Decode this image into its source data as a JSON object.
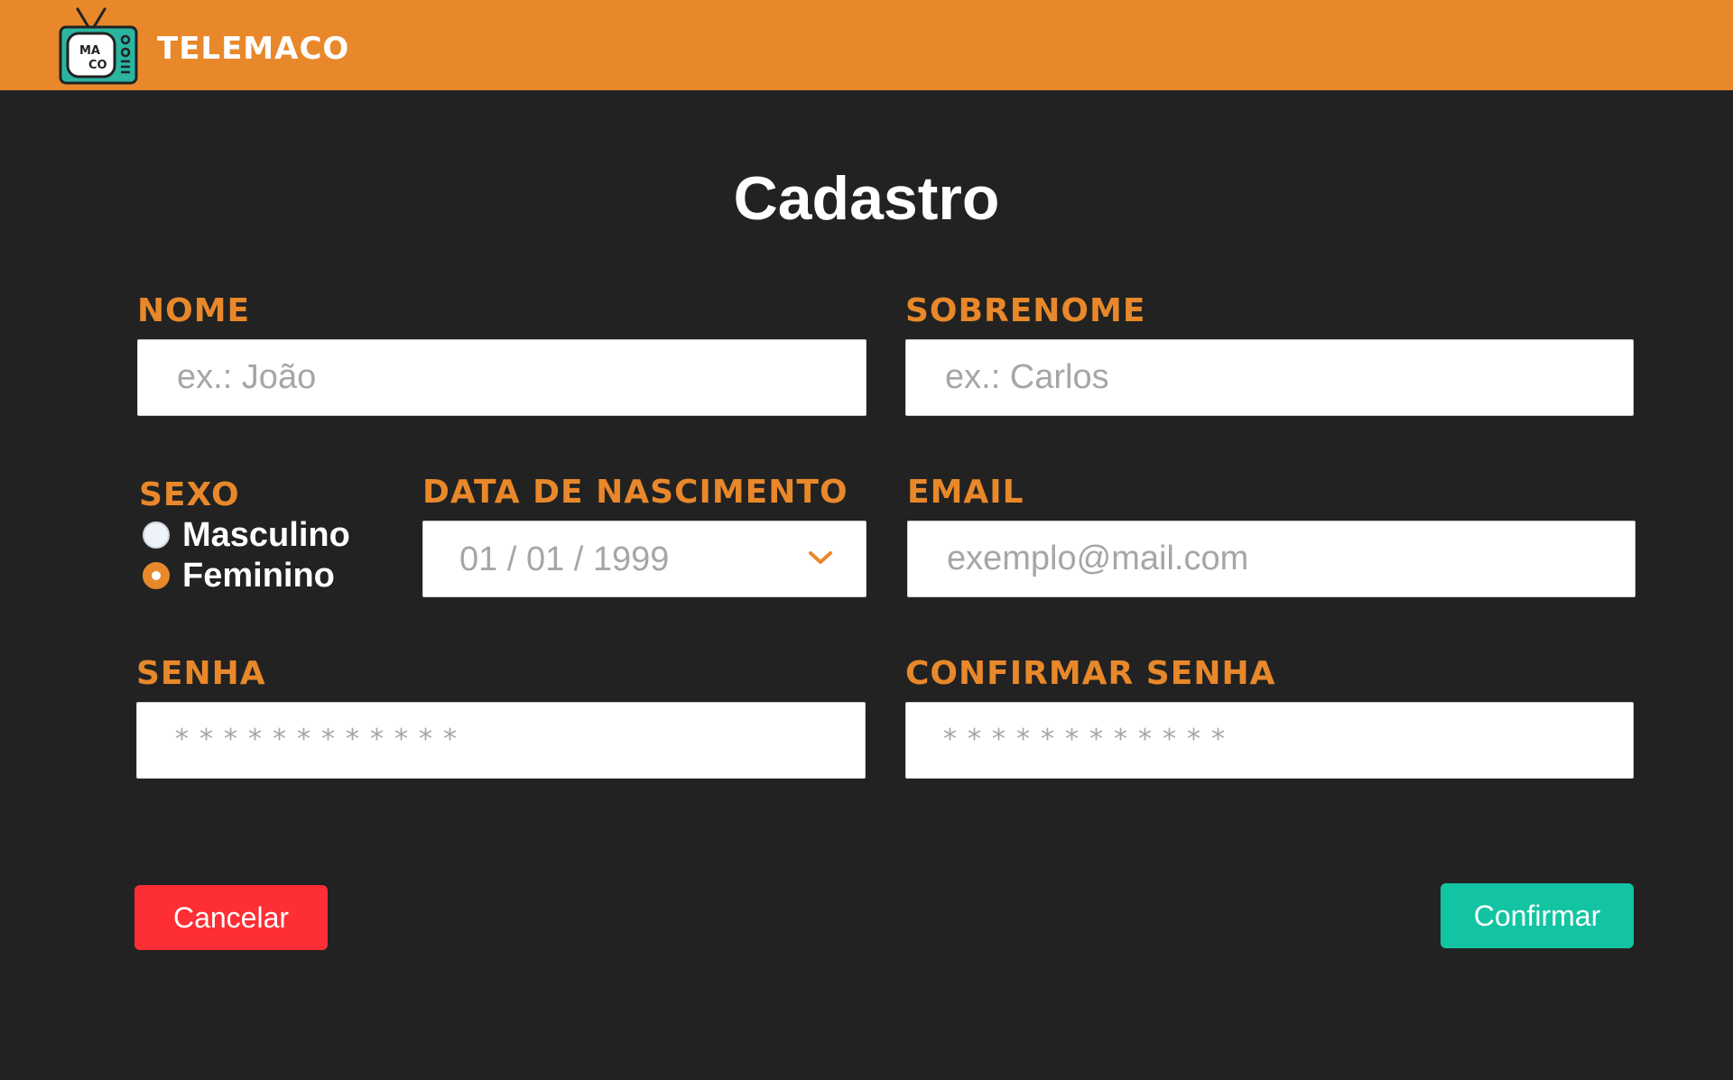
{
  "header": {
    "brand": "TELEMACO",
    "logo_text_top": "MA",
    "logo_text_bottom": "CO",
    "background_color": "#e8882b"
  },
  "page": {
    "title": "Cadastro"
  },
  "form": {
    "nome": {
      "label": "NOME",
      "placeholder": "ex.: João",
      "value": ""
    },
    "sobrenome": {
      "label": "SOBRENOME",
      "placeholder": "ex.: Carlos",
      "value": ""
    },
    "sexo": {
      "label": "SEXO",
      "options": [
        {
          "label": "Masculino",
          "selected": false
        },
        {
          "label": "Feminino",
          "selected": true
        }
      ]
    },
    "data_nascimento": {
      "label": "DATA DE NASCIMENTO",
      "value": "01 / 01 / 1999",
      "icon": "chevron-down-icon"
    },
    "email": {
      "label": "EMAIL",
      "placeholder": "exemplo@mail.com",
      "value": ""
    },
    "senha": {
      "label": "SENHA",
      "masked_placeholder": "************"
    },
    "confirmar_senha": {
      "label": "CONFIRMAR SENHA",
      "masked_placeholder": "************"
    }
  },
  "actions": {
    "cancel_label": "Cancelar",
    "confirm_label": "Confirmar",
    "cancel_color": "#fe2e35",
    "confirm_color": "#13c4a3"
  },
  "colors": {
    "background": "#222222",
    "accent": "#e8882b",
    "logo_teal": "#2bb5a0"
  }
}
